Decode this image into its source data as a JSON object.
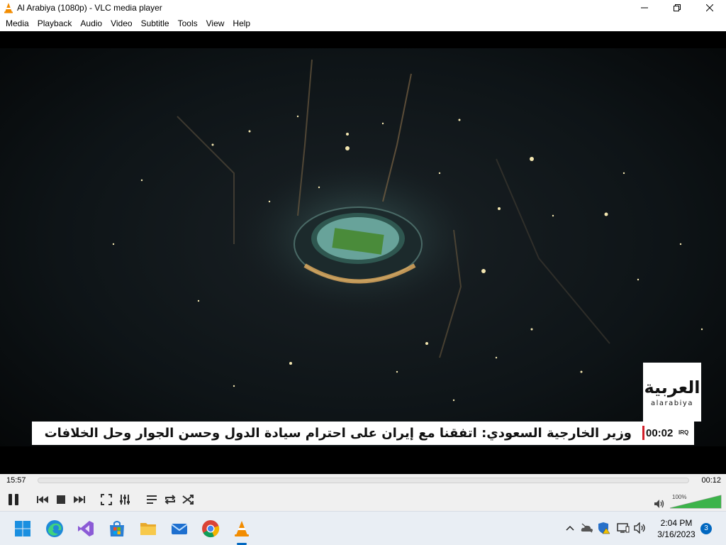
{
  "window": {
    "title": "Al Arabiya (1080p) - VLC media player",
    "minimize_icon": "minimize-icon",
    "maximize_icon": "restore-icon",
    "close_icon": "close-icon"
  },
  "menu": {
    "items": [
      "Media",
      "Playback",
      "Audio",
      "Video",
      "Subtitle",
      "Tools",
      "View",
      "Help"
    ]
  },
  "video": {
    "channel_logo_ar": "العربية",
    "channel_logo_en": "alarabiya",
    "ticker_headline": "وزير الخارجية السعودي: اتفقنا مع إيران على احترام سيادة الدول وحسن الجوار وحل الخلافات",
    "ticker_time": "00:02",
    "ticker_timezone": "IRQ"
  },
  "player": {
    "elapsed": "15:57",
    "remaining": "00:12",
    "progress": 0.0,
    "volume_label": "100%",
    "volume_level": 1.0
  },
  "controls": {
    "buttons": [
      "pause-icon",
      "previous-icon",
      "stop-icon",
      "next-icon",
      "fullscreen-icon",
      "extended-settings-icon",
      "playlist-icon",
      "loop-icon",
      "shuffle-icon"
    ]
  },
  "taskbar": {
    "apps": [
      "windows-start-icon",
      "edge-icon",
      "visual-studio-icon",
      "microsoft-store-icon",
      "file-explorer-icon",
      "mail-icon",
      "chrome-icon",
      "vlc-icon"
    ],
    "tray": [
      "show-hidden-icons-chevron",
      "onedrive-icon",
      "security-icon",
      "network-icon",
      "speaker-icon"
    ],
    "time": "2:04 PM",
    "date": "3/16/2023",
    "notification_count": "3"
  },
  "colors": {
    "vlc_orange": "#f28c00",
    "ticker_red": "#d21f2a",
    "volume_green": "#3cb34a",
    "windows_blue": "#0067c0"
  }
}
